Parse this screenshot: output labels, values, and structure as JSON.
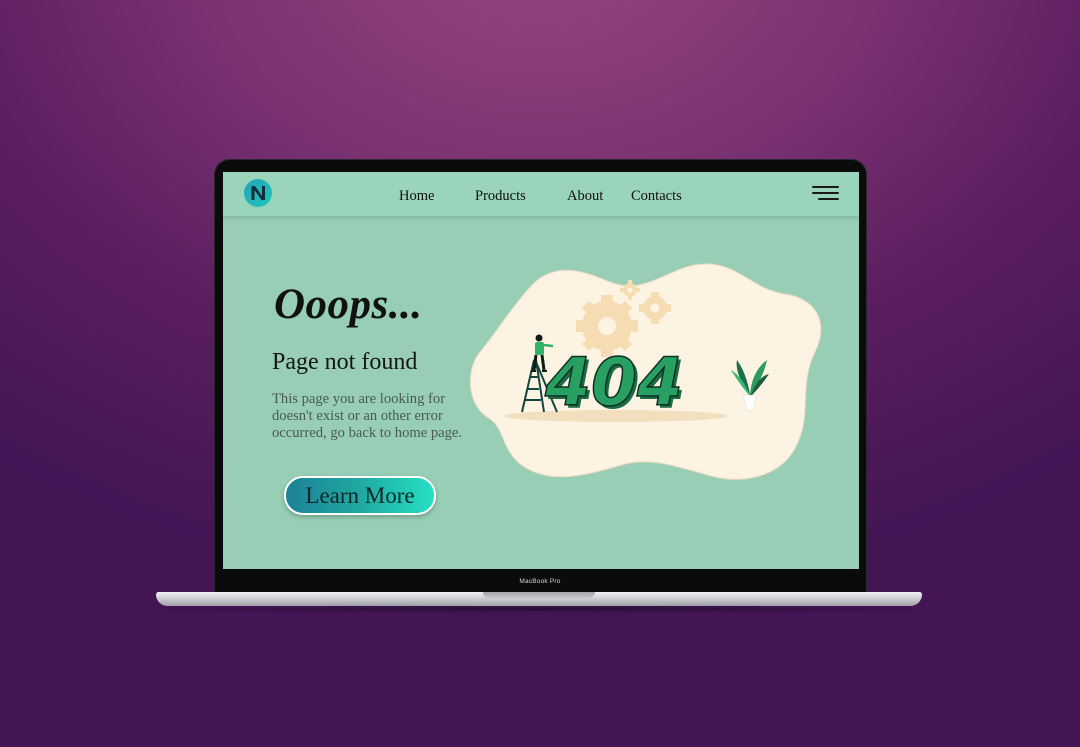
{
  "nav": {
    "logo_letter": "N",
    "links": [
      "Home",
      "Products",
      "About",
      "Contacts"
    ],
    "menu_icon": "hamburger-menu-icon"
  },
  "hero": {
    "headline": "Ooops...",
    "subheading": "Page not found",
    "description": "This page you are looking for doesn't exist or an other error occurred, go back to home page.",
    "cta_label": "Learn More"
  },
  "illustration": {
    "code": "404",
    "icons": [
      "gear-icon",
      "ladder-icon",
      "worker-figure",
      "plant-icon"
    ]
  },
  "device": {
    "label": "MacBook Pro"
  },
  "colors": {
    "background_top": "#98467f",
    "background_bottom": "#431555",
    "screen": "#97ceb5",
    "navbar": "#9ad4ba",
    "blob": "#fdf3e3",
    "gear": "#f5dcb3",
    "digits": "#27a062",
    "cta_start": "#1d8196",
    "cta_end": "#27e0c4"
  }
}
